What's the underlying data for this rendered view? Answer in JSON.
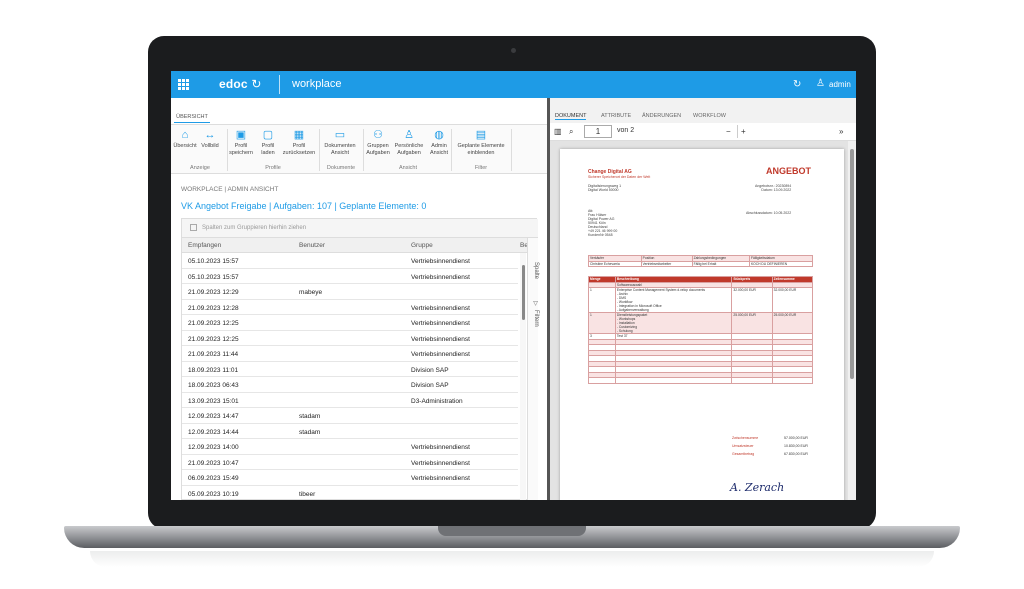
{
  "header": {
    "logo": "edoc",
    "app_title": "workplace",
    "user": "admin"
  },
  "ribbon": {
    "tab": "ÜBERSICHT",
    "buttons": [
      {
        "label": "Übersicht",
        "icon": "home-icon",
        "glyph": "⌂"
      },
      {
        "label": "Vollbild",
        "icon": "fullscreen-icon",
        "glyph": "↔"
      },
      {
        "label": "Profil speichern",
        "icon": "save-icon",
        "glyph": "▣"
      },
      {
        "label": "Profil laden",
        "icon": "file-icon",
        "glyph": "▢"
      },
      {
        "label": "Profil zurücksetzen",
        "icon": "grid-reset-icon",
        "glyph": "▦"
      },
      {
        "label": "Dokumenten Ansicht",
        "icon": "document-view-icon",
        "glyph": "▭"
      },
      {
        "label": "Gruppen Aufgaben",
        "icon": "group-tasks-icon",
        "glyph": "⚇"
      },
      {
        "label": "Persönliche Aufgaben",
        "icon": "personal-tasks-icon",
        "glyph": "♙"
      },
      {
        "label": "Admin Ansicht",
        "icon": "globe-icon",
        "glyph": "◍"
      },
      {
        "label": "Geplante Elemente einblenden",
        "icon": "scheduled-items-icon",
        "glyph": "▤"
      }
    ],
    "groups": [
      "Anzeige",
      "Profile",
      "Dokumente",
      "Ansicht",
      "Filter"
    ]
  },
  "breadcrumb": "WORKPLACE | ADMIN ANSICHT",
  "page_title": "VK Angebot Freigabe | Aufgaben: 107 | Geplante Elemente: 0",
  "grid": {
    "group_hint": "Spalten zum Gruppieren hierhin ziehen",
    "columns": [
      "Empfangen",
      "Benutzer",
      "Gruppe",
      "Be"
    ],
    "side_labels": [
      "Spalte",
      "Filtern"
    ],
    "rows": [
      [
        "05.10.2023 15:57",
        "",
        "Vertriebsinnendienst"
      ],
      [
        "05.10.2023 15:57",
        "",
        "Vertriebsinnendienst"
      ],
      [
        "21.09.2023 12:29",
        "mabeye",
        ""
      ],
      [
        "21.09.2023 12:28",
        "",
        "Vertriebsinnendienst"
      ],
      [
        "21.09.2023 12:25",
        "",
        "Vertriebsinnendienst"
      ],
      [
        "21.09.2023 12:25",
        "",
        "Vertriebsinnendienst"
      ],
      [
        "21.09.2023 11:44",
        "",
        "Vertriebsinnendienst"
      ],
      [
        "18.09.2023 11:01",
        "",
        "Division SAP"
      ],
      [
        "18.09.2023 06:43",
        "",
        "Division SAP"
      ],
      [
        "13.09.2023 15:01",
        "",
        "D3-Administration"
      ],
      [
        "12.09.2023 14:47",
        "stadam",
        ""
      ],
      [
        "12.09.2023 14:44",
        "stadam",
        ""
      ],
      [
        "12.09.2023 14:00",
        "",
        "Vertriebsinnendienst"
      ],
      [
        "21.09.2023 10:47",
        "",
        "Vertriebsinnendienst"
      ],
      [
        "06.09.2023 15:49",
        "",
        "Vertriebsinnendienst"
      ],
      [
        "05.09.2023 10:19",
        "tibeer",
        ""
      ]
    ]
  },
  "viewer": {
    "tabs": [
      "DOKUMENT",
      "ATTRIBUTE",
      "ÄNDERUNGEN",
      "WORKFLOW"
    ],
    "page": "1",
    "page_of": "von 2",
    "doc": {
      "company": "Change Digital AG",
      "tagline": "Sicherer Speicherort der Daten der Welt",
      "heading": "ANGEBOT",
      "sender": "Digitalisierungsweg 1\nDigital World 50000",
      "meta": "Angebotsnr.: 20230894\nDatum: 13.09.2022",
      "recipient": "Att:\nFrau Hülser\nDigital Power AG\n50941 Köln\nDeutschland\n+49 221 46 999 00\nKundenNr 0548",
      "validity": "Abschlussdatum: 10.05.2022",
      "info_head": [
        "Verkäufer",
        "Position",
        "Zahlungsbedingungen",
        "Fälligkeitsdatum"
      ],
      "info_row": [
        "Christine Echevarria",
        "Vertriebsmitarbeiter",
        "Fällig bei Erhalt",
        "KOCH DU DEFINIEREN"
      ],
      "items_head": [
        "Menge",
        "Beschreibung",
        "Stückpreis",
        "Zeilensumme"
      ],
      "items": [
        [
          "",
          "Softwareauswahl",
          "",
          ""
        ],
        [
          "1",
          "Enterprise Content Management System d.velop documents\n- Archiv\n- DMS\n- Workflow\n- Integration in Microsoft Office\n- Aufgabenverwaltung",
          "32.000,00 EUR",
          "32.000,00 EUR"
        ],
        [
          "1",
          "Dienstleistungspaket\n- Workshops\n- Installation\n- Customizing\n- Schulung",
          "25.000,00 EUR",
          "25.000,00 EUR"
        ],
        [
          "3",
          "Test 37",
          "",
          ""
        ]
      ],
      "totals_labels": [
        "Zwischensumme",
        "Umsatzsteuer",
        "Gesamtbetrag"
      ],
      "totals_values": [
        "57.000,00 EUR",
        "10.830,00 EUR",
        "67.830,00 EUR"
      ],
      "signature": "A. Zerach"
    }
  },
  "colors": {
    "accent": "#1e9be6",
    "doc_red": "#c0392b"
  }
}
